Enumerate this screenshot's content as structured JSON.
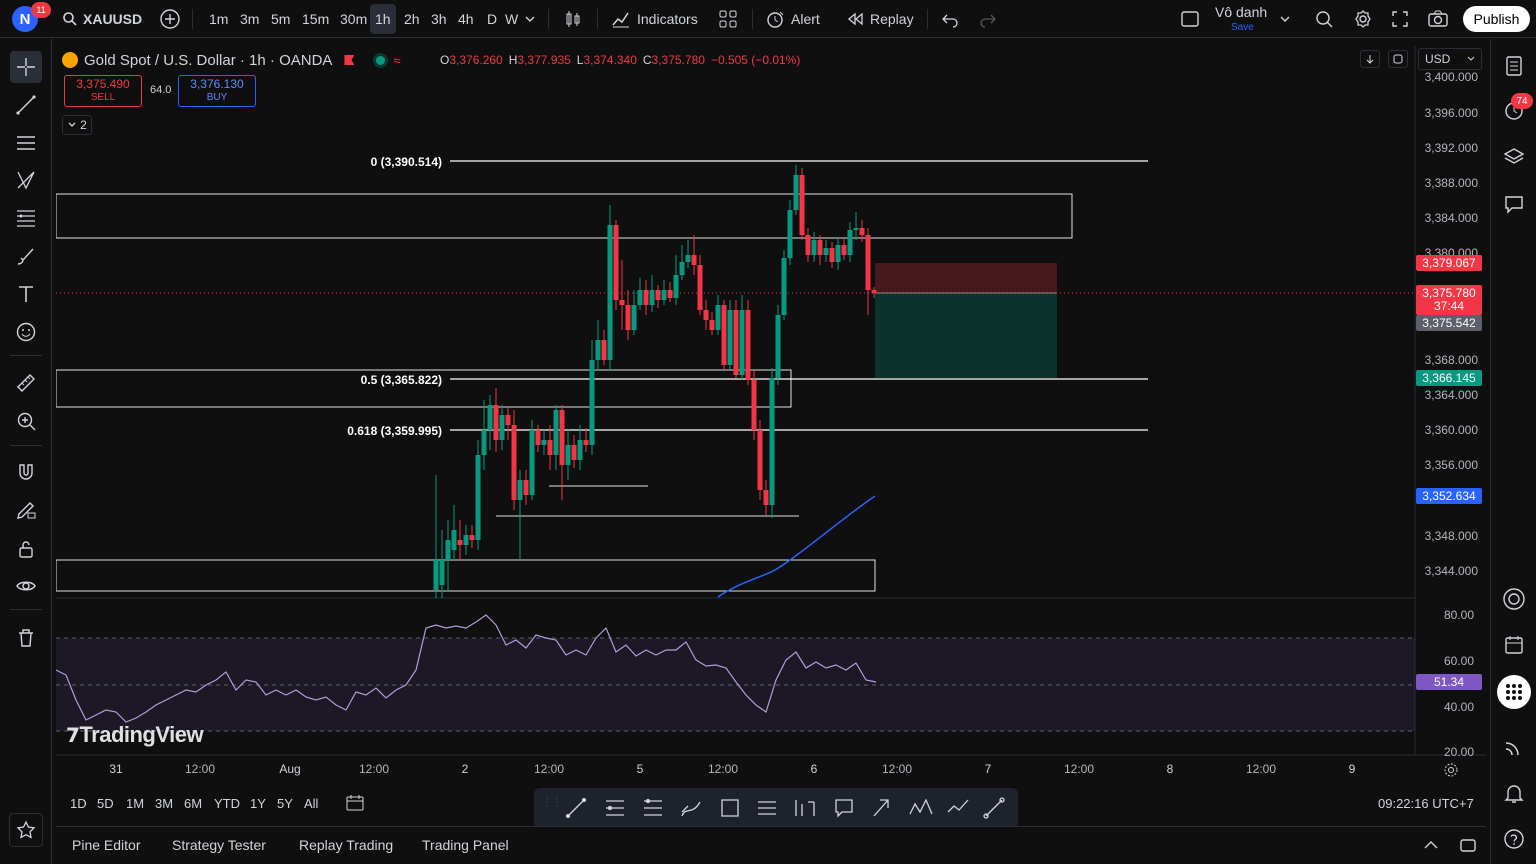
{
  "topbar": {
    "avatar_letter": "N",
    "avatar_badge": "11",
    "symbol": "XAUUSD",
    "intervals": [
      "1m",
      "3m",
      "5m",
      "15m",
      "30m",
      "1h",
      "2h",
      "3h",
      "4h",
      "D",
      "W"
    ],
    "active_interval": "1h",
    "indicators_label": "Indicators",
    "alert_label": "Alert",
    "replay_label": "Replay",
    "layout_name": "Vô danh",
    "layout_save": "Save",
    "publish_label": "Publish"
  },
  "legend": {
    "title": "Gold Spot / U.S. Dollar · 1h · OANDA",
    "o_label": "O",
    "o": "3,376.260",
    "h_label": "H",
    "h": "3,377.935",
    "l_label": "L",
    "l": "3,374.340",
    "c_label": "C",
    "c": "3,375.780",
    "change": "−0.505 (−0.01%)",
    "sell_price": "3,375.490",
    "sell_label": "SELL",
    "spread": "64.0",
    "buy_price": "3,376.130",
    "buy_label": "BUY",
    "collapse_count": "2"
  },
  "currency": "USD",
  "price_axis": [
    "3,400.000",
    "3,396.000",
    "3,392.000",
    "3,388.000",
    "3,384.000",
    "3,380.000",
    "3,368.000",
    "3,364.000",
    "3,360.000",
    "3,356.000",
    "3,348.000",
    "3,344.000"
  ],
  "price_tags": {
    "stop": "3,379.067",
    "last": "3,375.780",
    "countdown": "37:44",
    "bid": "3,375.542",
    "target": "3,366.145",
    "ma": "3,352.634",
    "rsi": "51.34"
  },
  "rsi_axis": [
    "80.00",
    "60.00",
    "40.00",
    "20.00"
  ],
  "time_axis": [
    "31",
    "12:00",
    "Aug",
    "12:00",
    "2",
    "12:00",
    "5",
    "12:00",
    "6",
    "12:00",
    "7",
    "12:00",
    "8",
    "12:00",
    "9"
  ],
  "fib": {
    "level_0": "0 (3,390.514)",
    "level_05": "0.5 (3,365.822)",
    "level_0618": "0.618 (3,359.995)"
  },
  "watermark": "TradingView",
  "ranges": [
    "1D",
    "5D",
    "1M",
    "3M",
    "6M",
    "YTD",
    "1Y",
    "5Y",
    "All"
  ],
  "clock": "09:22:16 UTC+7",
  "panels": [
    "Pine Editor",
    "Strategy Tester",
    "Replay Trading",
    "Trading Panel"
  ],
  "right_badge": "74",
  "colors": {
    "up": "#089981",
    "down": "#f23645",
    "accent": "#2962ff",
    "rsi": "#7e57c2"
  }
}
